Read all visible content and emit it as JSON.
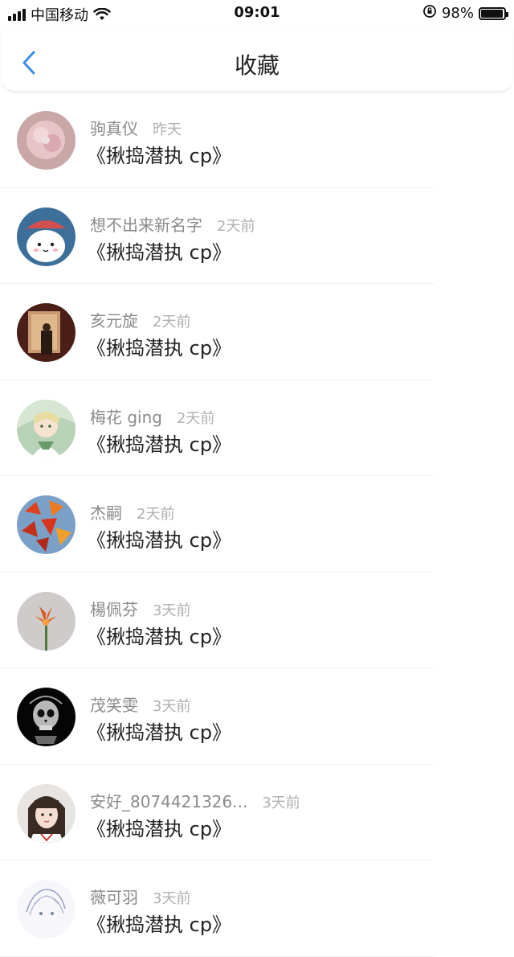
{
  "status_bar": {
    "carrier": "中国移动",
    "time": "09:01",
    "battery": "98%",
    "battery_level": 0.98
  },
  "nav": {
    "title": "收藏"
  },
  "favorites": [
    {
      "user": "驹真仪",
      "time": "昨天",
      "title": "《揪捣潜执 cp》"
    },
    {
      "user": "想不出来新名字",
      "time": "2天前",
      "title": "《揪捣潜执 cp》"
    },
    {
      "user": "亥元旋",
      "time": "2天前",
      "title": "《揪捣潜执 cp》"
    },
    {
      "user": "梅花 ging",
      "time": "2天前",
      "title": "《揪捣潜执 cp》"
    },
    {
      "user": "杰嗣",
      "time": "2天前",
      "title": "《揪捣潜执 cp》"
    },
    {
      "user": "楊佩芬",
      "time": "3天前",
      "title": "《揪捣潜执 cp》"
    },
    {
      "user": "茂笑雯",
      "time": "3天前",
      "title": "《揪捣潜执 cp》"
    },
    {
      "user": "安好_8074421326...",
      "time": "3天前",
      "title": "《揪捣潜执 cp》"
    },
    {
      "user": "薇可羽",
      "time": "3天前",
      "title": "《揪捣潜执 cp》"
    }
  ],
  "colors": {
    "accent": "#3a8ee6",
    "username": "#8a8a8a",
    "timestamp": "#b0b0b0"
  }
}
